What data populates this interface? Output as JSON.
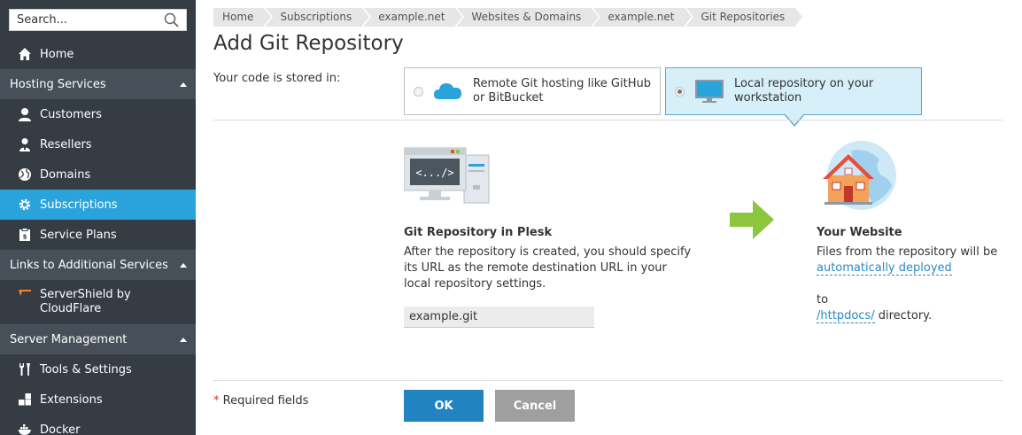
{
  "sidebar": {
    "search_placeholder": "Search...",
    "items": [
      {
        "label": "Home",
        "icon": "home-icon"
      },
      {
        "section": "Hosting Services"
      },
      {
        "label": "Customers",
        "icon": "user-icon"
      },
      {
        "label": "Resellers",
        "icon": "reseller-icon"
      },
      {
        "label": "Domains",
        "icon": "globe-icon"
      },
      {
        "label": "Subscriptions",
        "icon": "gear-icon",
        "active": true
      },
      {
        "label": "Service Plans",
        "icon": "plan-icon"
      },
      {
        "section": "Links to Additional Services"
      },
      {
        "label": "ServerShield by CloudFlare",
        "icon": "cloudflare-icon"
      },
      {
        "section": "Server Management"
      },
      {
        "label": "Tools & Settings",
        "icon": "tools-icon"
      },
      {
        "label": "Extensions",
        "icon": "extensions-icon"
      },
      {
        "label": "Docker",
        "icon": "docker-icon"
      }
    ],
    "home": "Home",
    "hosting_services": "Hosting Services",
    "customers": "Customers",
    "resellers": "Resellers",
    "domains": "Domains",
    "subscriptions": "Subscriptions",
    "service_plans": "Service Plans",
    "links_additional": "Links to Additional Services",
    "servershield": "ServerShield by CloudFlare",
    "server_management": "Server Management",
    "tools_settings": "Tools & Settings",
    "extensions": "Extensions",
    "docker": "Docker"
  },
  "breadcrumb": [
    "Home",
    "Subscriptions",
    "example.net",
    "Websites & Domains",
    "example.net",
    "Git Repositories"
  ],
  "page_title": "Add Git Repository",
  "form": {
    "stored_label": "Your code is stored in:",
    "option_remote": "Remote Git hosting like GitHub or BitBucket",
    "option_local": "Local repository on your workstation",
    "selected": "local",
    "plesk_title": "Git Repository in Plesk",
    "plesk_desc": "After the repository is created, you should specify its URL as the remote destination URL in your local repository settings.",
    "repo_name": "example.git",
    "site_title": "Your Website",
    "site_desc": "Files from the repository will be",
    "deploy_link": "automatically deployed",
    "to": "to",
    "dir_link": "/httpdocs/",
    "dir_suffix": " directory.",
    "illus_code": "<.../>"
  },
  "footer": {
    "required_star": "*",
    "required_label": " Required fields",
    "ok": "OK",
    "cancel": "Cancel"
  },
  "colors": {
    "sidebar_bg": "#353c44",
    "section_bg": "#475059",
    "active": "#2aa3db",
    "ok_button": "#2183bf",
    "cancel_button": "#9f9f9f",
    "selected_option": "#d6eff9",
    "arrow": "#8cc63f",
    "link": "#2a88c7"
  }
}
